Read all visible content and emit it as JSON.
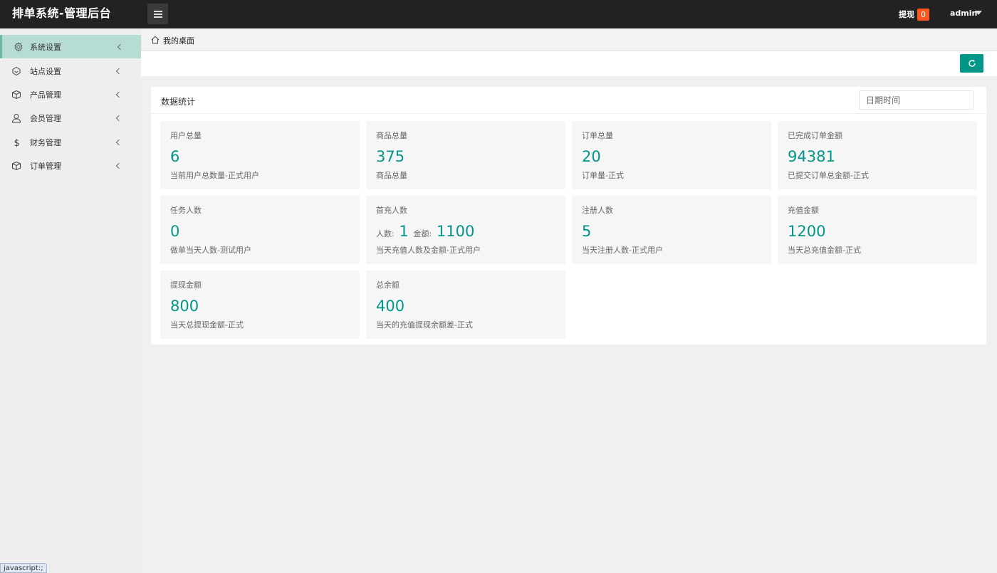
{
  "header": {
    "app_title": "排单系统-管理后台",
    "withdraw_label": "提现",
    "withdraw_count": "0",
    "user_name": "admin"
  },
  "sidebar": {
    "items": [
      {
        "label": "系统设置",
        "icon": "gear-icon",
        "active": true
      },
      {
        "label": "站点设置",
        "icon": "site-icon",
        "active": false
      },
      {
        "label": "产品管理",
        "icon": "box-icon",
        "active": false
      },
      {
        "label": "会员管理",
        "icon": "user-icon",
        "active": false
      },
      {
        "label": "财务管理",
        "icon": "dollar-icon",
        "active": false
      },
      {
        "label": "订单管理",
        "icon": "box-icon",
        "active": false
      }
    ]
  },
  "breadcrumb": {
    "label": "我的桌面"
  },
  "status_bar": {
    "text": "javascript:;"
  },
  "stats_card": {
    "title": "数据统计",
    "date_placeholder": "日期时间",
    "stats": [
      {
        "title": "用户总量",
        "value": "6",
        "desc": "当前用户总数量-正式用户"
      },
      {
        "title": "商品总量",
        "value": "375",
        "desc": "商品总量"
      },
      {
        "title": "订单总量",
        "value": "20",
        "desc": "订单量-正式"
      },
      {
        "title": "已完成订单金额",
        "value": "94381",
        "desc": "已提交订单总金额-正式"
      },
      {
        "title": "任务人数",
        "value": "0",
        "desc": "做单当天人数-测试用户"
      },
      {
        "title": "首充人数",
        "people_label": "人数:",
        "people_value": "1",
        "amount_label": "金额:",
        "amount_value": "1100",
        "desc": "当天充值人数及金额-正式用户"
      },
      {
        "title": "注册人数",
        "value": "5",
        "desc": "当天注册人数-正式用户"
      },
      {
        "title": "充值金额",
        "value": "1200",
        "desc": "当天总充值金额-正式"
      },
      {
        "title": "提现金额",
        "value": "800",
        "desc": "当天总提现金额-正式"
      },
      {
        "title": "总余额",
        "value": "400",
        "desc": "当天的充值提现余额差-正式"
      }
    ]
  },
  "colors": {
    "accent": "#009688",
    "badge": "#ff5722",
    "active_menu": "#b6dcd4"
  }
}
